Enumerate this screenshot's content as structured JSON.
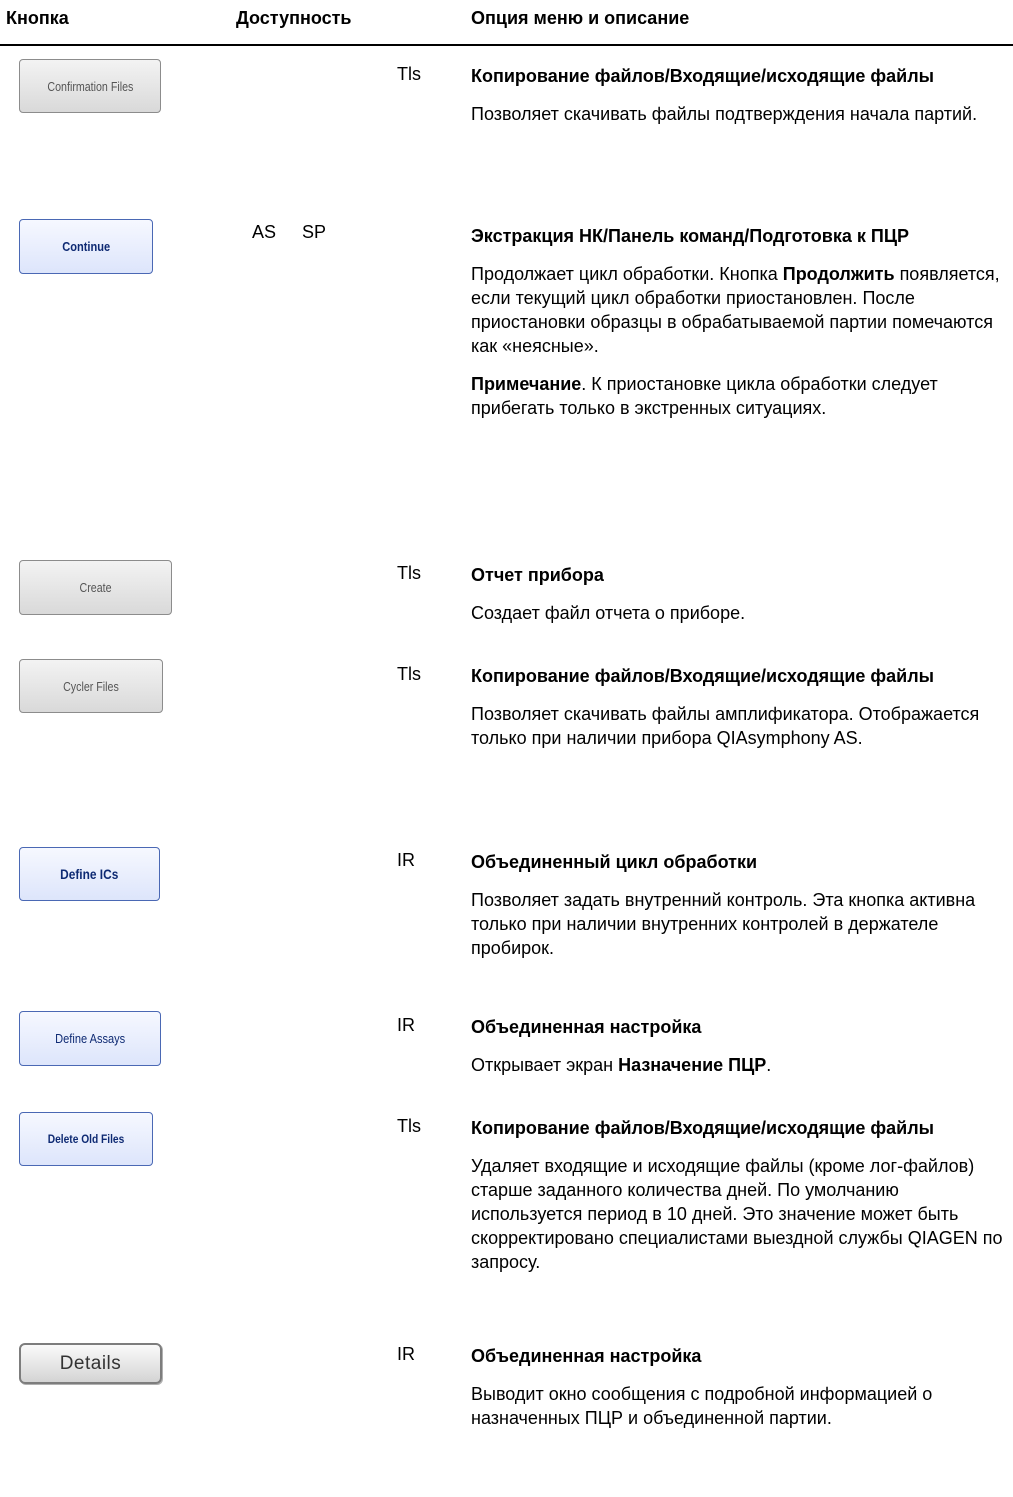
{
  "header": {
    "col_button": "Кнопка",
    "col_availability": "Доступность",
    "col_description": "Опция меню и описание"
  },
  "rows": [
    {
      "button_label": "Confirmation Files",
      "availability": [
        "Tls"
      ],
      "title": "Копирование файлов/Входящие/исходящие файлы",
      "text": "Позволяет скачивать файлы подтверждения начала партий."
    },
    {
      "button_label": "Continue",
      "availability": [
        "AS",
        "SP"
      ],
      "title": "Экстракция НК/Панель команд/Подготовка к ПЦР",
      "text_before_bold": "Продолжает цикл обработки. Кнопка ",
      "text_bold": "Продолжить",
      "text_after_bold": " появляется, если текущий цикл обработки приостановлен. После приостановки образцы в обрабатываемой партии помечаются как «неясные».",
      "note_label": "Примечание",
      "note_text": ". К приостановке цикла обработки следует прибегать только в экстренных ситуациях."
    },
    {
      "button_label": "Create",
      "availability": [
        "Tls"
      ],
      "title": "Отчет прибора",
      "text": "Создает файл отчета о приборе."
    },
    {
      "button_label": "Cycler Files",
      "availability": [
        "Tls"
      ],
      "title": "Копирование файлов/Входящие/исходящие файлы",
      "text": "Позволяет скачивать файлы амплификатора. Отображается только при наличии прибора QIAsymphony AS."
    },
    {
      "button_label": "Define ICs",
      "availability": [
        "IR"
      ],
      "title": "Объединенный цикл обработки",
      "text": "Позволяет задать внутренний контроль. Эта кнопка активна только при наличии внутренних контролей в держателе пробирок."
    },
    {
      "button_label": "Define Assays",
      "availability": [
        "IR"
      ],
      "title": "Объединенная настройка",
      "text_before_bold": "Открывает экран ",
      "text_bold": "Назначение ПЦР",
      "text_after_bold": "."
    },
    {
      "button_label": "Delete Old Files",
      "availability": [
        "Tls"
      ],
      "title": "Копирование файлов/Входящие/исходящие файлы",
      "text": "Удаляет входящие и исходящие файлы (кроме лог-файлов) старше заданного количества дней. По умолчанию используется период в 10 дней. Это значение может быть скорректировано специалистами выездной службы QIAGEN по запросу."
    },
    {
      "button_label": "Details",
      "availability": [
        "IR"
      ],
      "title": "Объединенная настройка",
      "text": "Выводит окно сообщения с подробной информацией о назначенных ПЦР и объединенной партии."
    }
  ]
}
